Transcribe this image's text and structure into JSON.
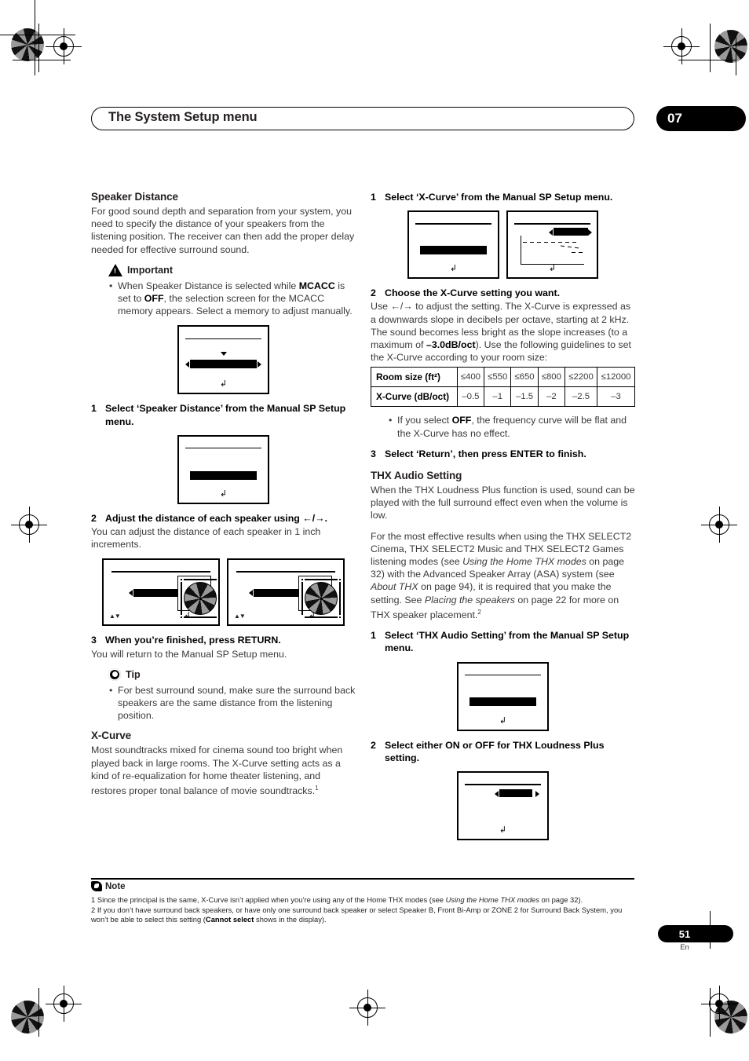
{
  "header": {
    "chapter_title": "The System Setup menu",
    "chapter_number": "07"
  },
  "left_column": {
    "speaker_distance": {
      "heading": "Speaker Distance",
      "intro": "For good sound depth and separation from your system, you need to specify the distance of your speakers from the listening position. The receiver can then add the proper delay needed for effective surround sound.",
      "important_label": "Important",
      "important_bullet_pre": "When Speaker Distance is selected while ",
      "important_bold_1": "MCACC",
      "important_mid": " is set to ",
      "important_bold_2": "OFF",
      "important_post": ", the selection screen for the MCACC memory appears. Select a memory to adjust manually.",
      "step1_num": "1",
      "step1_text": "Select ‘Speaker Distance’ from the Manual SP Setup menu.",
      "step2_num": "2",
      "step2_text": "Adjust the distance of each speaker using ←/→.",
      "step2_body": "You can adjust the distance of each speaker in 1 inch increments.",
      "step3_num": "3",
      "step3_text": "When you’re finished, press RETURN.",
      "step3_body": "You will return to the Manual SP Setup menu.",
      "tip_label": "Tip",
      "tip_bullet": "For best surround sound, make sure the surround back speakers are the same distance from the listening position."
    },
    "x_curve": {
      "heading": "X-Curve",
      "body_pre": "Most soundtracks mixed for cinema sound too bright when played back in large rooms. The X-Curve setting acts as a kind of re-equalization for home theater listening, and restores proper tonal balance of movie soundtracks.",
      "footnote_ref": "1"
    }
  },
  "right_column": {
    "x_curve_steps": {
      "step1_num": "1",
      "step1_text": "Select ‘X-Curve’ from the Manual SP Setup menu.",
      "step2_num": "2",
      "step2_text": "Choose the X-Curve setting you want.",
      "step2_body_pre": "Use ←/→ to adjust the setting. The X-Curve is expressed as a downwards slope in decibels per octave, starting at 2 kHz. The sound becomes less bright as the slope increases (to a maximum of ",
      "step2_bold": "–3.0dB/oct",
      "step2_body_post": "). Use the following guidelines to set the X-Curve according to your room size:",
      "off_bullet_pre": "If you select ",
      "off_bullet_bold": "OFF",
      "off_bullet_post": ", the frequency curve will be flat and the X-Curve has no effect.",
      "step3_num": "3",
      "step3_text": "Select ‘Return’, then press ENTER to finish."
    },
    "thx_audio": {
      "heading": "THX Audio Setting",
      "para1": "When the THX Loudness Plus function is used, sound can be played with the full surround effect even when the volume is low.",
      "para2_a": "For the most effective results when using the THX SELECT2 Cinema, THX SELECT2 Music and THX SELECT2 Games listening modes (see ",
      "para2_i1": "Using the Home THX modes",
      "para2_b": " on page 32) with the Advanced Speaker Array (ASA) system (see ",
      "para2_i2": "About THX",
      "para2_c": " on page 94), it is required that you make the setting. See ",
      "para2_i3": "Placing the speakers",
      "para2_d": " on page 22 for more on THX speaker placement.",
      "para2_footnote": "2",
      "step1_num": "1",
      "step1_text": "Select ‘THX Audio Setting’ from the Manual SP Setup menu.",
      "step2_num": "2",
      "step2_text": "Select either ON or OFF for THX Loudness Plus setting."
    }
  },
  "room_table": {
    "row_header_1": "Room size (ft²)",
    "row_header_2": "X-Curve (dB/oct)",
    "room_sizes": [
      "≤400",
      "≤550",
      "≤650",
      "≤800",
      "≤2200",
      "≤12000"
    ],
    "x_curve_values": [
      "–0.5",
      "–1",
      "–1.5",
      "–2",
      "–2.5",
      "–3"
    ]
  },
  "notes": {
    "label": "Note",
    "note1_pre": "1 Since the principal is the same, X-Curve isn’t applied when you’re using any of the Home THX modes (see ",
    "note1_italic": "Using the Home THX modes",
    "note1_post": " on page 32).",
    "note2_pre": "2 If you don’t have surround back speakers, or have only one surround back speaker or select Speaker B, Front Bi-Amp or ZONE 2 for Surround Back System, you won’t be able to select this setting (",
    "note2_bold": "Cannot select",
    "note2_post": " shows in the display)."
  },
  "footer": {
    "page_number": "51",
    "language": "En"
  },
  "colors": {
    "ink": "#231f20",
    "body_gray": "#3a3a3c",
    "accent": "#000000"
  }
}
